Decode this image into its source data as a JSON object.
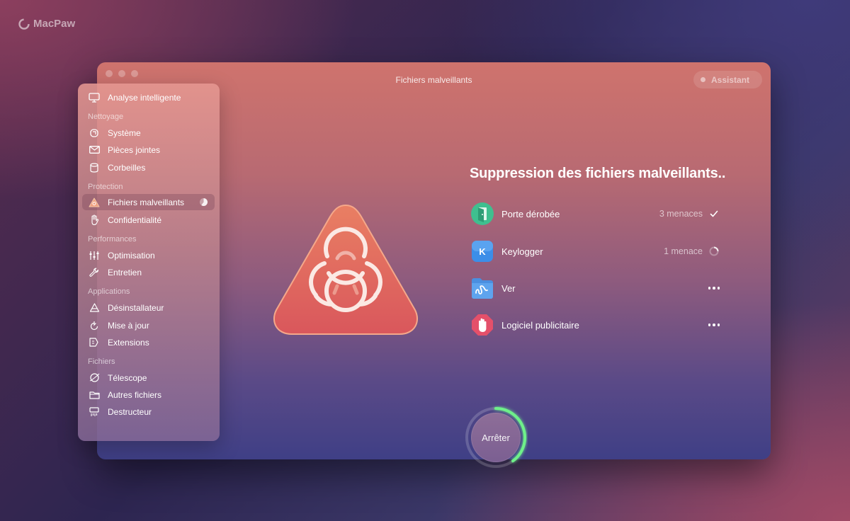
{
  "brand": {
    "name": "MacPaw"
  },
  "window": {
    "title": "Fichiers malveillants",
    "assistant_label": "Assistant"
  },
  "sidebar": {
    "top_item": {
      "label": "Analyse intelligente",
      "icon": "monitor-icon"
    },
    "sections": [
      {
        "header": "Nettoyage",
        "items": [
          {
            "label": "Système",
            "icon": "system-icon"
          },
          {
            "label": "Pièces jointes",
            "icon": "mail-icon"
          },
          {
            "label": "Corbeilles",
            "icon": "trash-bins-icon"
          }
        ]
      },
      {
        "header": "Protection",
        "items": [
          {
            "label": "Fichiers malveillants",
            "icon": "biohazard-icon",
            "active": true,
            "progress": 0.6
          },
          {
            "label": "Confidentialité",
            "icon": "hand-icon"
          }
        ]
      },
      {
        "header": "Performances",
        "items": [
          {
            "label": "Optimisation",
            "icon": "sliders-icon"
          },
          {
            "label": "Entretien",
            "icon": "wrench-icon"
          }
        ]
      },
      {
        "header": "Applications",
        "items": [
          {
            "label": "Désinstallateur",
            "icon": "uninstaller-icon"
          },
          {
            "label": "Mise à jour",
            "icon": "updater-icon"
          },
          {
            "label": "Extensions",
            "icon": "extensions-icon"
          }
        ]
      },
      {
        "header": "Fichiers",
        "items": [
          {
            "label": "Télescope",
            "icon": "planet-icon"
          },
          {
            "label": "Autres fichiers",
            "icon": "folder-icon"
          },
          {
            "label": "Destructeur",
            "icon": "shredder-icon"
          }
        ]
      }
    ]
  },
  "main": {
    "heading": "Suppression des fichiers malveillants..",
    "threats": [
      {
        "name": "Porte dérobée",
        "count": "3 menaces",
        "status": "done",
        "icon": "backdoor-icon",
        "color": "#3fbf8f"
      },
      {
        "name": "Keylogger",
        "count": "1 menace",
        "status": "in-progress",
        "icon": "keylogger-icon",
        "letter": "K",
        "color": "#3c8ee8"
      },
      {
        "name": "Ver",
        "count": "",
        "status": "pending",
        "icon": "worm-icon",
        "color": "#4a8fe0"
      },
      {
        "name": "Logiciel publicitaire",
        "count": "",
        "status": "pending",
        "icon": "adware-icon",
        "color": "#e4506a"
      }
    ],
    "stop_button": {
      "label": "Arrêter",
      "progress": 0.4
    }
  },
  "colors": {
    "accent_green": "#6ef08a",
    "hazard_red": "#e36b5d"
  }
}
